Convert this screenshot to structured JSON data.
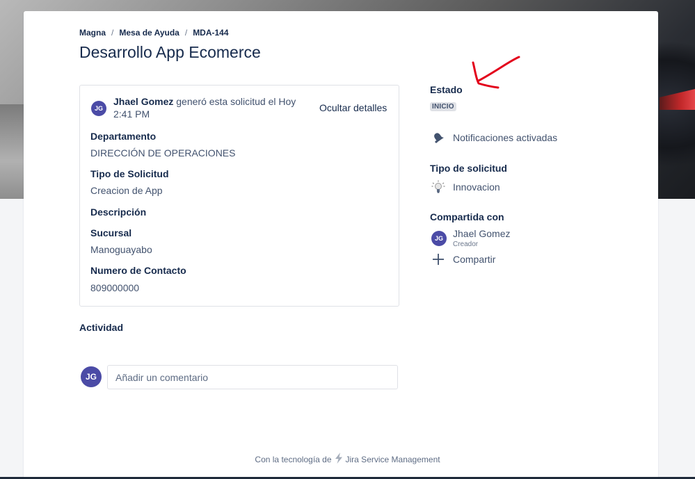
{
  "breadcrumb": [
    "Magna",
    "Mesa de Ayuda",
    "MDA-144"
  ],
  "title": "Desarrollo App Ecomerce",
  "request": {
    "creator_initials": "JG",
    "creator_name": "Jhael Gomez",
    "created_text": "generó esta solicitud el Hoy 2:41 PM",
    "hide_details_label": "Ocultar detalles",
    "fields": [
      {
        "label": "Departamento",
        "value": "DIRECCIÓN DE OPERACIONES"
      },
      {
        "label": "Tipo de Solicitud",
        "value": "Creacion de App"
      },
      {
        "label": "Descripción",
        "value": ""
      },
      {
        "label": "Sucursal",
        "value": "Manoguayabo"
      },
      {
        "label": "Numero de Contacto",
        "value": "809000000"
      }
    ]
  },
  "activity": {
    "title": "Actividad",
    "avatar_initials": "JG",
    "comment_placeholder": "Añadir un comentario"
  },
  "sidebar": {
    "status_label": "Estado",
    "status_value": "INICIO",
    "notifications_label": "Notificaciones activadas",
    "notifications_icon": "bell-icon",
    "request_type_label": "Tipo de solicitud",
    "request_type_value": "Innovacion",
    "request_type_icon": "lightbulb-icon",
    "shared_label": "Compartida con",
    "shared_user_initials": "JG",
    "shared_user_name": "Jhael Gomez",
    "shared_user_role": "Creador",
    "share_label": "Compartir",
    "share_icon": "plus-icon"
  },
  "footer": {
    "prefix": "Con la tecnología de",
    "product": "Jira Service Management",
    "icon": "bolt-icon"
  },
  "colors": {
    "avatar": "#4b4ba6",
    "annotation_arrow": "#e3001b",
    "lozenge_bg": "#dfe1e6"
  }
}
